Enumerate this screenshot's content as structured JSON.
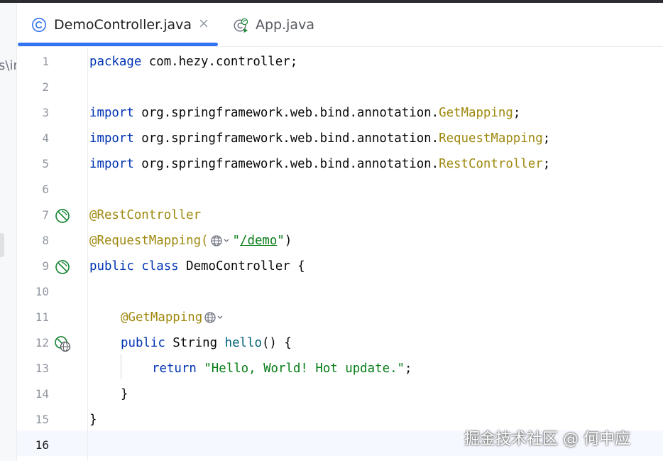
{
  "left_panel": {
    "clipped_text": "s\\ir"
  },
  "tabs": [
    {
      "label": "DemoController.java",
      "icon": "class-c-icon",
      "active": true
    },
    {
      "label": "App.java",
      "icon": "spring-app-icon",
      "active": false
    }
  ],
  "editor": {
    "current_line": 16,
    "lines": [
      {
        "num": "1",
        "text": "package com.hezy.controller;"
      },
      {
        "num": "2",
        "text": ""
      },
      {
        "num": "3",
        "text": "import org.springframework.web.bind.annotation.GetMapping;"
      },
      {
        "num": "4",
        "text": "import org.springframework.web.bind.annotation.RequestMapping;"
      },
      {
        "num": "5",
        "text": "import org.springframework.web.bind.annotation.RestController;"
      },
      {
        "num": "6",
        "text": ""
      },
      {
        "num": "7",
        "text": "@RestController",
        "gutter_icon": "spring-bean-icon"
      },
      {
        "num": "8",
        "text": "@RequestMapping(\"/demo\")"
      },
      {
        "num": "9",
        "text": "public class DemoController {",
        "gutter_icon": "spring-bean-icon"
      },
      {
        "num": "10",
        "text": ""
      },
      {
        "num": "11",
        "text": "@GetMapping"
      },
      {
        "num": "12",
        "text": "public String hello() {",
        "gutter_icon": "web-endpoint-icon"
      },
      {
        "num": "13",
        "text": "return \"Hello, World! Hot update.\";"
      },
      {
        "num": "14",
        "text": "}"
      },
      {
        "num": "15",
        "text": "}"
      },
      {
        "num": "16",
        "text": ""
      }
    ]
  },
  "tokens": {
    "l1_kw": "package",
    "l1_rest": " com.hezy.controller;",
    "import_kw": "import",
    "l3_pkg": " org.springframework.web.bind.annotation.",
    "l3_cls": "GetMapping",
    "l4_cls": "RequestMapping",
    "l5_cls": "RestController",
    "semi": ";",
    "l7_ann": "@RestController",
    "l8_ann": "@RequestMapping(",
    "l8_q1": "\"",
    "l8_url": "/demo",
    "l8_q2": "\"",
    "l8_close": ")",
    "l9_kw": "public class",
    "l9_rest": " DemoController {",
    "l11_ann": "@GetMapping",
    "l12_kw": "public",
    "l12_type": " String ",
    "l12_meth": "hello",
    "l12_rest": "() {",
    "l13_kw": "return",
    "l13_str": "\"Hello, World! Hot update.\"",
    "l14_text": "}",
    "l15_text": "}"
  },
  "watermark": "掘金技术社区 @ 何中应",
  "colors": {
    "keyword": "#0033b3",
    "annotation": "#9e880d",
    "string": "#067d17",
    "method": "#00627a",
    "accent_tab_underline": "#3574f0",
    "gutter_icon_green": "#208a3c"
  }
}
